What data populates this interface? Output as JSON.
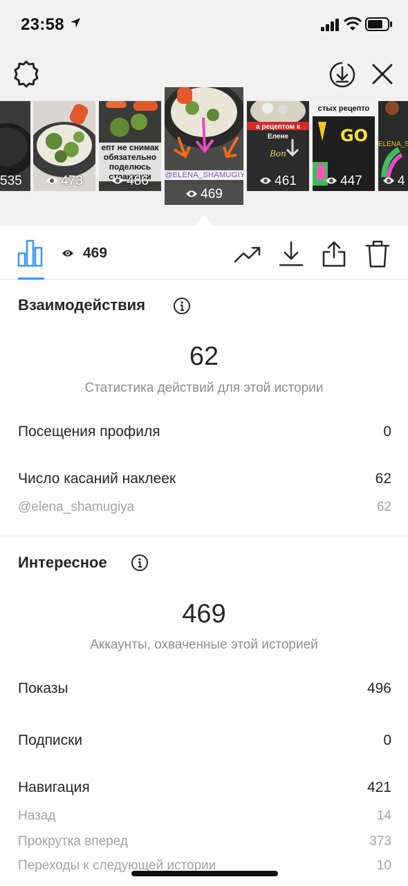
{
  "status_bar": {
    "time": "23:58"
  },
  "stories": [
    {
      "views": "535",
      "overlay": ""
    },
    {
      "views": "473",
      "overlay": ""
    },
    {
      "views": "486",
      "overlay": "епт не снимак обязательно поделюсь странички"
    },
    {
      "views": "469",
      "overlay": "@ELENA_SHAMUGIYA",
      "selected": true
    },
    {
      "views": "461",
      "overlay": "а рецептом к Елене"
    },
    {
      "views": "447",
      "overlay": "стых рецепто"
    },
    {
      "views": "4",
      "overlay": "ELENA_SHA"
    }
  ],
  "toolbar": {
    "views": "469"
  },
  "interactions": {
    "title": "Взаимодействия",
    "total": "62",
    "caption": "Статистика действий для этой истории",
    "rows": [
      {
        "label": "Посещения профиля",
        "value": "0"
      },
      {
        "label": "Число касаний наклеек",
        "value": "62"
      },
      {
        "label": "@elena_shamugiya",
        "value": "62"
      }
    ]
  },
  "discovery": {
    "title": "Интересное",
    "total": "469",
    "caption": "Аккаунты, охваченные этой историей",
    "rows": [
      {
        "label": "Показы",
        "value": "496"
      },
      {
        "label": "Подписки",
        "value": "0"
      },
      {
        "label": "Навигация",
        "value": "421"
      },
      {
        "label": "Назад",
        "value": "14"
      },
      {
        "label": "Прокрутка вперед",
        "value": "373"
      },
      {
        "label": "Переходы к следующей истории",
        "value": "10"
      }
    ]
  },
  "colors": {
    "accent": "#3897f0",
    "text": "#262626",
    "muted": "#8e8e8e"
  }
}
